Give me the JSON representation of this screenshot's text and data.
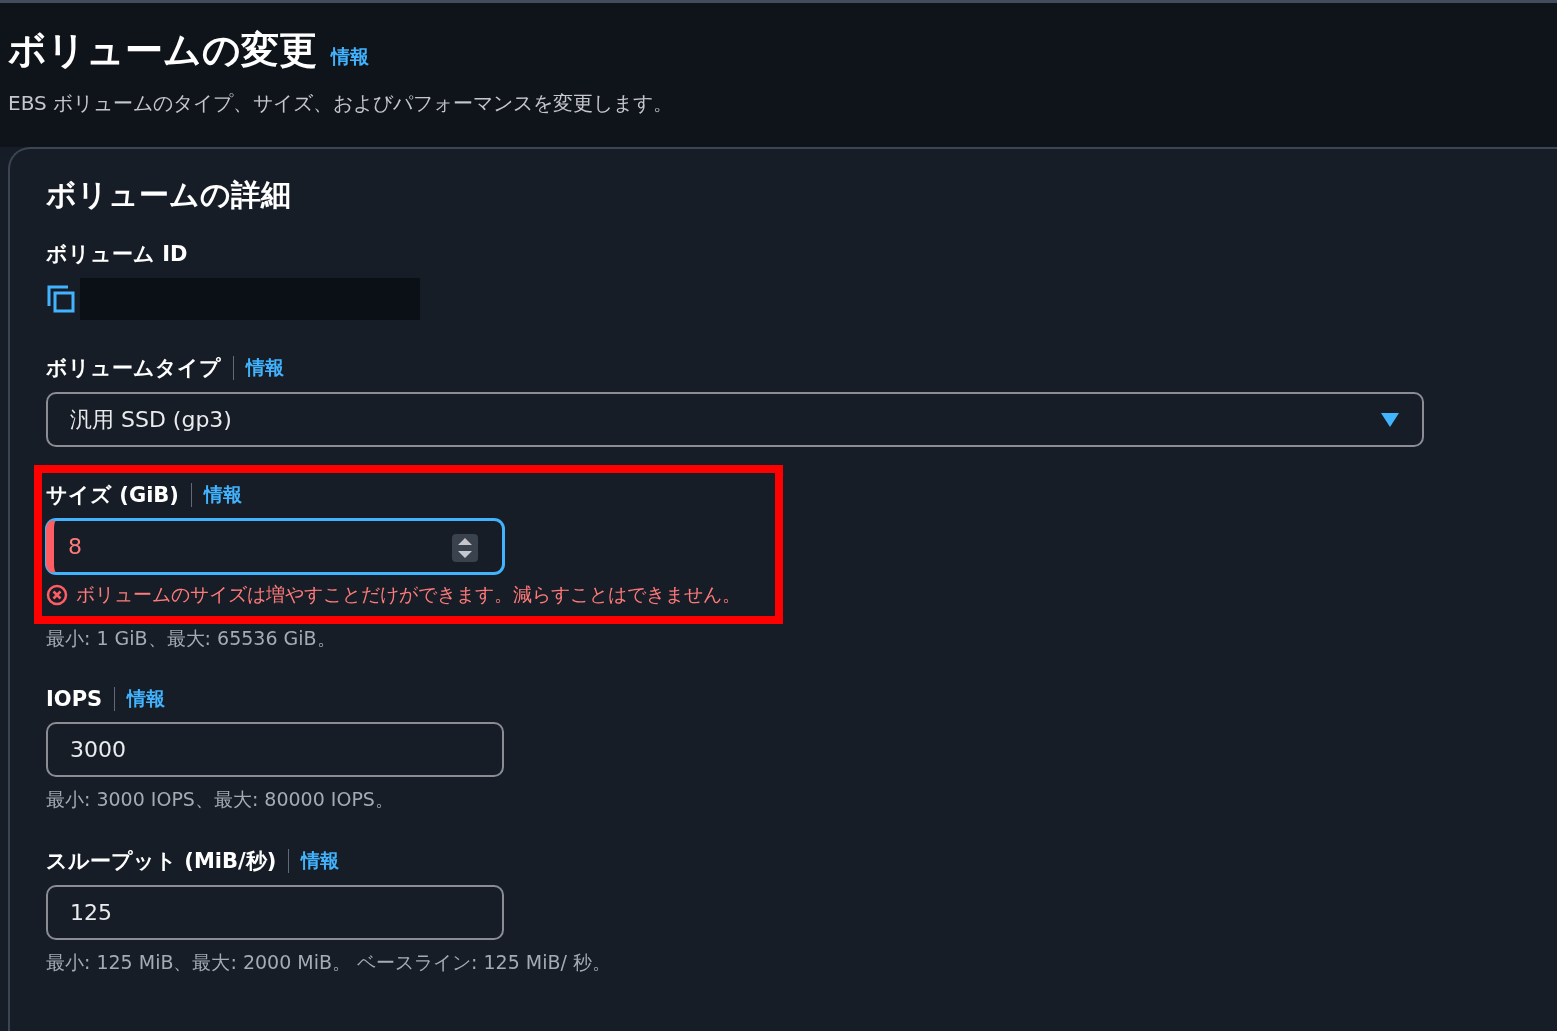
{
  "header": {
    "title": "ボリュームの変更",
    "info": "情報",
    "description": "EBS ボリュームのタイプ、サイズ、およびパフォーマンスを変更します。"
  },
  "card": {
    "title": "ボリュームの詳細",
    "fields": [
      {
        "kind": "readonly",
        "label": "ボリューム ID"
      },
      {
        "kind": "select",
        "label": "ボリュームタイプ",
        "info": "情報",
        "value": "汎用 SSD (gp3)"
      },
      {
        "kind": "number",
        "label": "サイズ (GiB)",
        "info": "情報",
        "value": "8",
        "focused": true,
        "error": true,
        "highlighted": true,
        "error_message": "ボリュームのサイズは増やすことだけができます。減らすことはできません。",
        "constraint": "最小: 1 GiB、最大: 65536 GiB。"
      },
      {
        "kind": "text",
        "label": "IOPS",
        "info": "情報",
        "value": "3000",
        "focused": false,
        "error": false,
        "highlighted": false,
        "constraint": "最小: 3000 IOPS、最大: 80000 IOPS。"
      },
      {
        "kind": "text",
        "label": "スループット (MiB/秒)",
        "info": "情報",
        "value": "125",
        "focused": false,
        "error": false,
        "highlighted": false,
        "constraint": "最小: 125 MiB、最大: 2000 MiB。 ベースライン: 125 MiB/ 秒。"
      }
    ]
  }
}
